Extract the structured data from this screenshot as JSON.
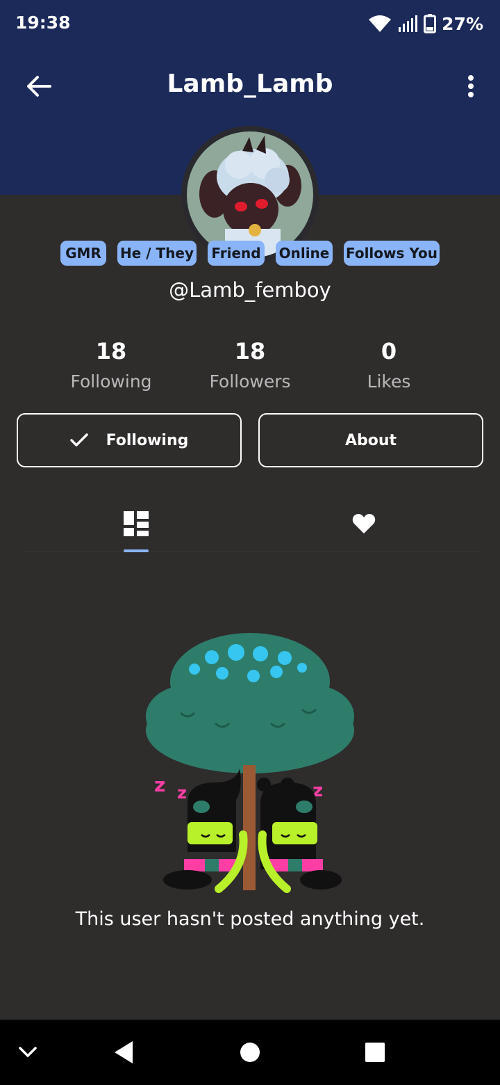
{
  "status_bar": {
    "time": "19:38",
    "battery": "27%"
  },
  "app_bar": {
    "title": "Lamb_Lamb"
  },
  "profile": {
    "badges": [
      "GMR",
      "He / They",
      "Friend",
      "Online",
      "Follows You"
    ],
    "handle": "@Lamb_femboy",
    "stats": [
      {
        "value": "18",
        "label": "Following"
      },
      {
        "value": "18",
        "label": "Followers"
      },
      {
        "value": "0",
        "label": "Likes"
      }
    ]
  },
  "actions": {
    "following_label": "Following",
    "about_label": "About"
  },
  "tabs": [
    {
      "icon": "grid-icon",
      "selected": true
    },
    {
      "icon": "heart-icon",
      "selected": false
    }
  ],
  "empty_state": {
    "message": "This user hasn't posted anything yet."
  },
  "colors": {
    "header": "#1b2a59",
    "background": "#2f2c2c",
    "accent": "#8ab4f8",
    "nav": "#000000"
  }
}
